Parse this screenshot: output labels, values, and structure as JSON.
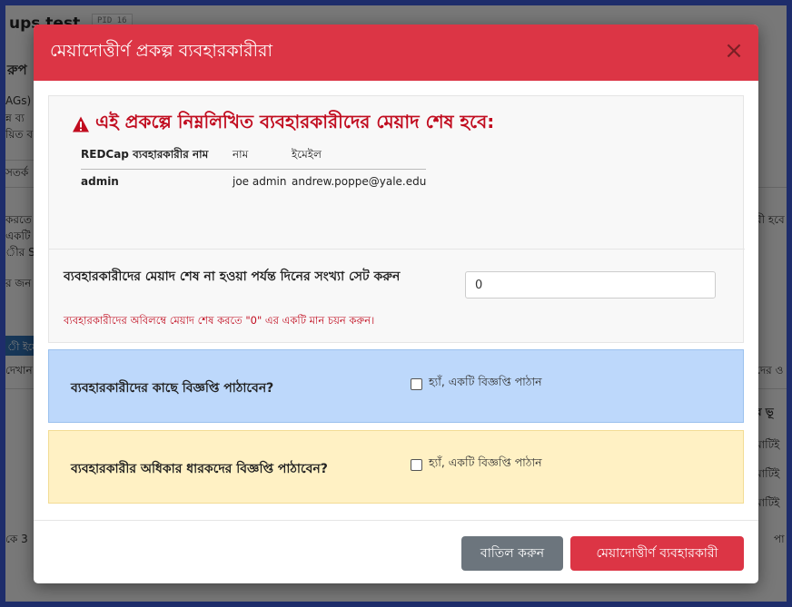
{
  "background": {
    "title": "ups test",
    "pid": "PID 16",
    "fragments": [
      {
        "text": "রুপ"
      },
      {
        "text": "AGs)"
      },
      {
        "text": "ন্ন ব্য"
      },
      {
        "text": "য়িত ব"
      },
      {
        "text": "সতর্ক"
      },
      {
        "text": "করতে"
      },
      {
        "text": "একটি"
      },
      {
        "text": "ীর SA"
      },
      {
        "text": "র জন"
      },
      {
        "text": "দেখান"
      },
      {
        "text": "কে 3"
      },
      {
        "text": "রী হবে"
      },
      {
        "text": "দের ও"
      },
      {
        "text": "র ভূ"
      },
      {
        "text": "মাটিই"
      },
      {
        "text": "মাটিই"
      },
      {
        "text": "মাটিই"
      },
      {
        "text": "পা"
      }
    ],
    "blue_tab": "ী ইমে"
  },
  "modal": {
    "title": "মেয়াদোত্তীর্ণ প্রকল্প ব্যবহারকারীরা",
    "close_label": "×",
    "warning": {
      "icon": "warning-triangle-icon",
      "text": "এই প্রকল্পে নিম্নলিখিত ব্যবহারকারীদের মেয়াদ শেষ হবে:"
    },
    "users_table": {
      "headers": [
        "REDCap ব্যবহারকারীর নাম",
        "নাম",
        "ইমেইল"
      ],
      "rows": [
        {
          "username": "admin",
          "name": "joe admin",
          "email": "andrew.poppe@yale.edu"
        }
      ]
    },
    "days": {
      "label": "ব্যবহারকারীদের মেয়াদ শেষ না হওয়া পর্যন্ত দিনের সংখ্যা সেট করুন",
      "value": "0",
      "hint": "ব্যবহারকারীদের অবিলম্বে মেয়াদ শেষ করতে \"0\" এর একটি মান চয়ন করুন।"
    },
    "notify_users": {
      "label": "ব্যবহারকারীদের কাছে বিজ্ঞপ্তি পাঠাবেন?",
      "checkbox_label": "হ্যাঁ, একটি বিজ্ঞপ্তি পাঠান",
      "checked": false
    },
    "notify_owners": {
      "label": "ব্যবহারকারীর অধিকার ধারকদের বিজ্ঞপ্তি পাঠাবেন?",
      "checkbox_label": "হ্যাঁ, একটি বিজ্ঞপ্তি পাঠান",
      "checked": false
    },
    "buttons": {
      "cancel": "বাতিল করুন",
      "expire": "মেয়াদোত্তীর্ণ ব্যবহারকারী"
    }
  },
  "colors": {
    "header": "#dc3545",
    "warning_text": "#c10c1f",
    "info_panel": "#bdd8fb",
    "warning_panel": "#fff1c4",
    "secondary_button": "#6c757d",
    "border_frame": "#3d5bd6"
  }
}
